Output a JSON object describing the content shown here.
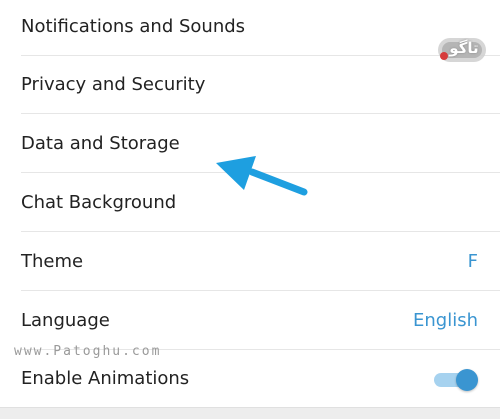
{
  "settings": {
    "items": [
      {
        "label": "Notifications and Sounds"
      },
      {
        "label": "Privacy and Security"
      },
      {
        "label": "Data and Storage"
      },
      {
        "label": "Chat Background"
      },
      {
        "label": "Theme",
        "value": "F"
      },
      {
        "label": "Language",
        "value": "English"
      },
      {
        "label": "Enable Animations",
        "toggle": "on"
      }
    ]
  },
  "watermark": {
    "url": "www.Patoghu.com",
    "logo": "تاگو"
  },
  "icons": {
    "annotation": "arrow-pointer-icon",
    "toggle": "toggle-switch-icon"
  },
  "colors": {
    "accent": "#3a95d1",
    "accent_light": "#a6d2ef",
    "arrow": "#1e9fe0",
    "text": "#222222",
    "divider": "#e6e6e6"
  }
}
